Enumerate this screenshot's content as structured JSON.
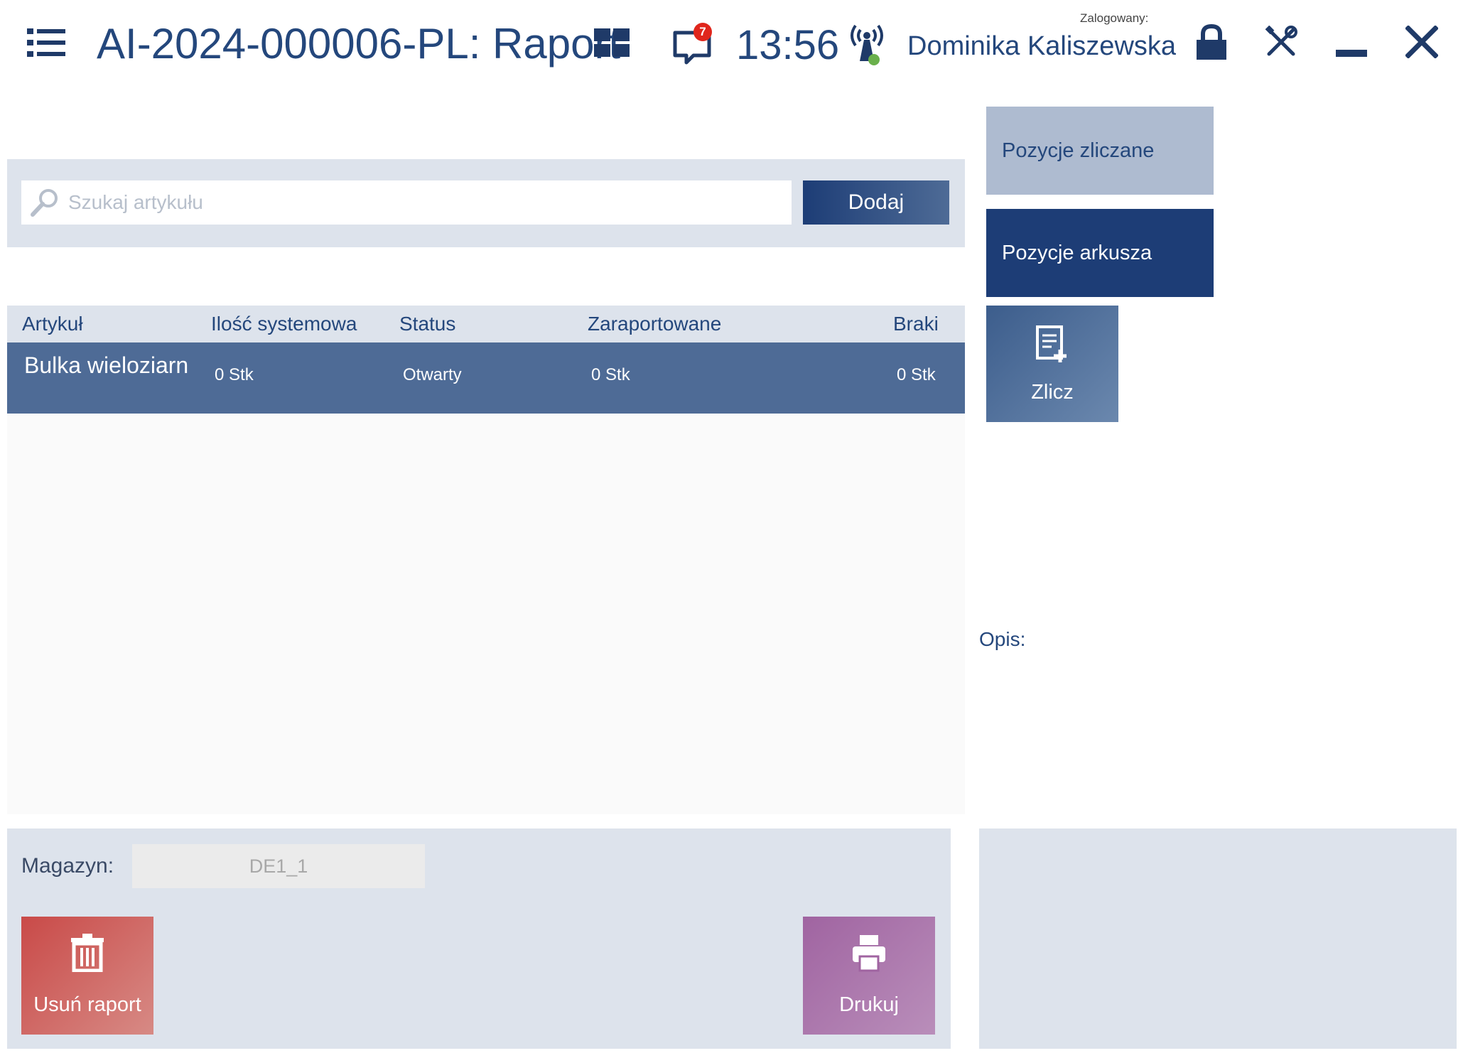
{
  "header": {
    "title": "AI-2024-000006-PL: Raport",
    "notification_count": "7",
    "time": "13:56",
    "logged_in_label": "Zalogowany:",
    "user_name": "Dominika Kaliszewska"
  },
  "search": {
    "placeholder": "Szukaj artykułu",
    "value": "",
    "add_label": "Dodaj"
  },
  "grid": {
    "columns": [
      "Artykuł",
      "Ilość systemowa",
      "Status",
      "Zaraportowane",
      "Braki"
    ],
    "rows": [
      {
        "article": "Bulka wieloziarn",
        "system_qty": "0 Stk",
        "status": "Otwarty",
        "reported": "0 Stk",
        "shortage": "0 Stk"
      }
    ]
  },
  "side": {
    "counted_label": "Pozycje zliczane",
    "sheet_label": "Pozycje arkusza",
    "count_label": "Zlicz",
    "description_label": "Opis:"
  },
  "footer": {
    "warehouse_label": "Magazyn:",
    "warehouse_value": "DE1_1",
    "delete_label": "Usuń raport",
    "print_label": "Drukuj"
  },
  "colors": {
    "primary": "#1d3d76",
    "selected_row": "#4e6b96",
    "panel": "#dde3ec",
    "delete": "#c94a48",
    "print": "#a064a1",
    "badge": "#e0261c"
  },
  "icons": {
    "menu": "list-menu-icon",
    "tiles": "tiles-icon",
    "messages": "chat-icon",
    "signal": "signal-tower-icon",
    "lock": "lock-icon",
    "tools": "tools-icon",
    "minimize": "minimize-icon",
    "close": "close-icon",
    "search": "search-icon",
    "count": "document-add-icon",
    "delete": "trash-icon",
    "print": "printer-icon"
  }
}
